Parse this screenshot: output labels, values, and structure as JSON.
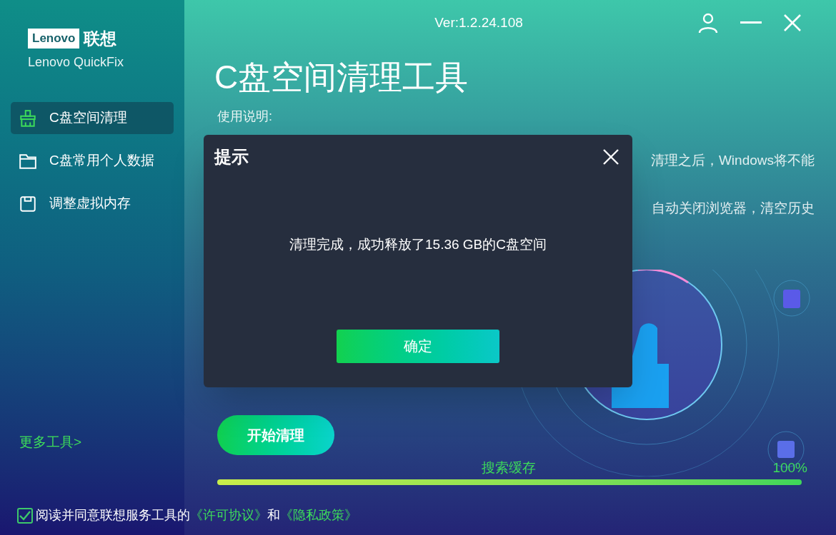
{
  "window": {
    "version": "Ver:1.2.24.108"
  },
  "brand": {
    "logo_en": "Lenovo",
    "logo_cn": "联想",
    "product": "Lenovo QuickFix"
  },
  "sidebar": {
    "items": [
      {
        "label": "C盘空间清理",
        "kind": "broom",
        "selected": true
      },
      {
        "label": "C盘常用个人数据",
        "kind": "folder",
        "selected": false
      },
      {
        "label": "调整虚拟内存",
        "kind": "disk",
        "selected": false
      }
    ],
    "more_tools": "更多工具>"
  },
  "agreement": {
    "checked": true,
    "text": "阅读并同意联想服务工具的",
    "link1": "《许可协议》",
    "and": "和",
    "link2": "《隐私政策》"
  },
  "main": {
    "title": "C盘空间清理工具",
    "instructions_label": "使用说明:",
    "instruction_lines": [
      "清理之后，Windows将不能",
      "自动关闭浏览器，清空历史"
    ],
    "start_button": "开始清理",
    "progress": {
      "label": "搜索缓存",
      "reading": "100%",
      "level": 1
    }
  },
  "dialog": {
    "title": "提示",
    "message": "清理完成，成功释放了15.36 GB的C盘空间",
    "ok_button": "确定"
  }
}
